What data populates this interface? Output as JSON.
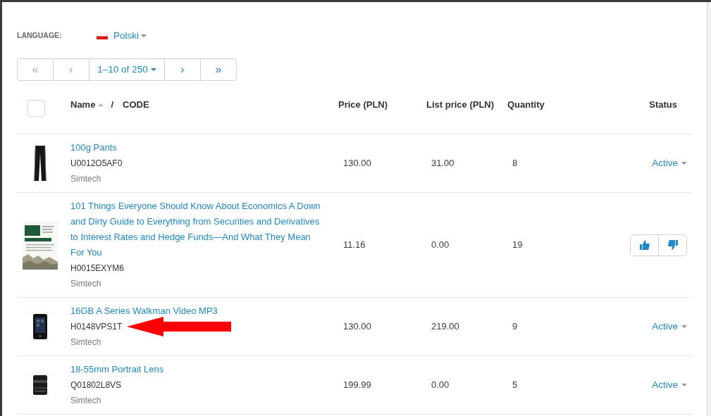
{
  "language": {
    "label": "LANGUAGE:",
    "value": "Polski"
  },
  "pagination": [
    {
      "kind": "nav",
      "label": "«",
      "disabled": true
    },
    {
      "kind": "nav",
      "label": "‹",
      "disabled": true
    },
    {
      "kind": "range",
      "label": "1–10 of 250"
    },
    {
      "kind": "nav",
      "label": "›",
      "disabled": false
    },
    {
      "kind": "nav",
      "label": "»",
      "disabled": false
    }
  ],
  "table": {
    "select_all": {
      "checked": false
    },
    "columns": [
      {
        "kind": "name",
        "label": "Name",
        "sort_ascending": true,
        "separator": "/",
        "code_label": "CODE"
      },
      {
        "kind": "price",
        "label": "Price (PLN)"
      },
      {
        "kind": "list_price",
        "label": "List price (PLN)"
      },
      {
        "kind": "quantity",
        "label": "Quantity"
      },
      {
        "kind": "status",
        "label": "Status"
      }
    ],
    "rows": [
      {
        "name": "100g Pants",
        "code": "U0012O5AF0",
        "vendor": "Simtech",
        "price": "130.00",
        "list_price": "31.00",
        "quantity": "8",
        "status": {
          "kind": "dropdown",
          "label": "Active"
        }
      },
      {
        "name": "101 Things Everyone Should Know About Economics A Down and Dirty Guide to Everything from Securities and Derivatives to Interest Rates and Hedge Funds—And What They Mean For You",
        "code": "H0015EXYM6",
        "vendor": "Simtech",
        "price": "11.16",
        "list_price": "0.00",
        "quantity": "19",
        "status": {
          "kind": "approval"
        }
      },
      {
        "name": "16GB A Series Walkman Video MP3",
        "code": "H0148VPS1T",
        "vendor": "Simtech",
        "price": "130.00",
        "list_price": "219.00",
        "quantity": "9",
        "status": {
          "kind": "dropdown",
          "label": "Active"
        }
      },
      {
        "name": "18-55mm Portrait Lens",
        "code": "Q01802L8VS",
        "vendor": "Simtech",
        "price": "199.99",
        "list_price": "0.00",
        "quantity": "5",
        "status": {
          "kind": "dropdown",
          "label": "Active"
        }
      }
    ]
  }
}
